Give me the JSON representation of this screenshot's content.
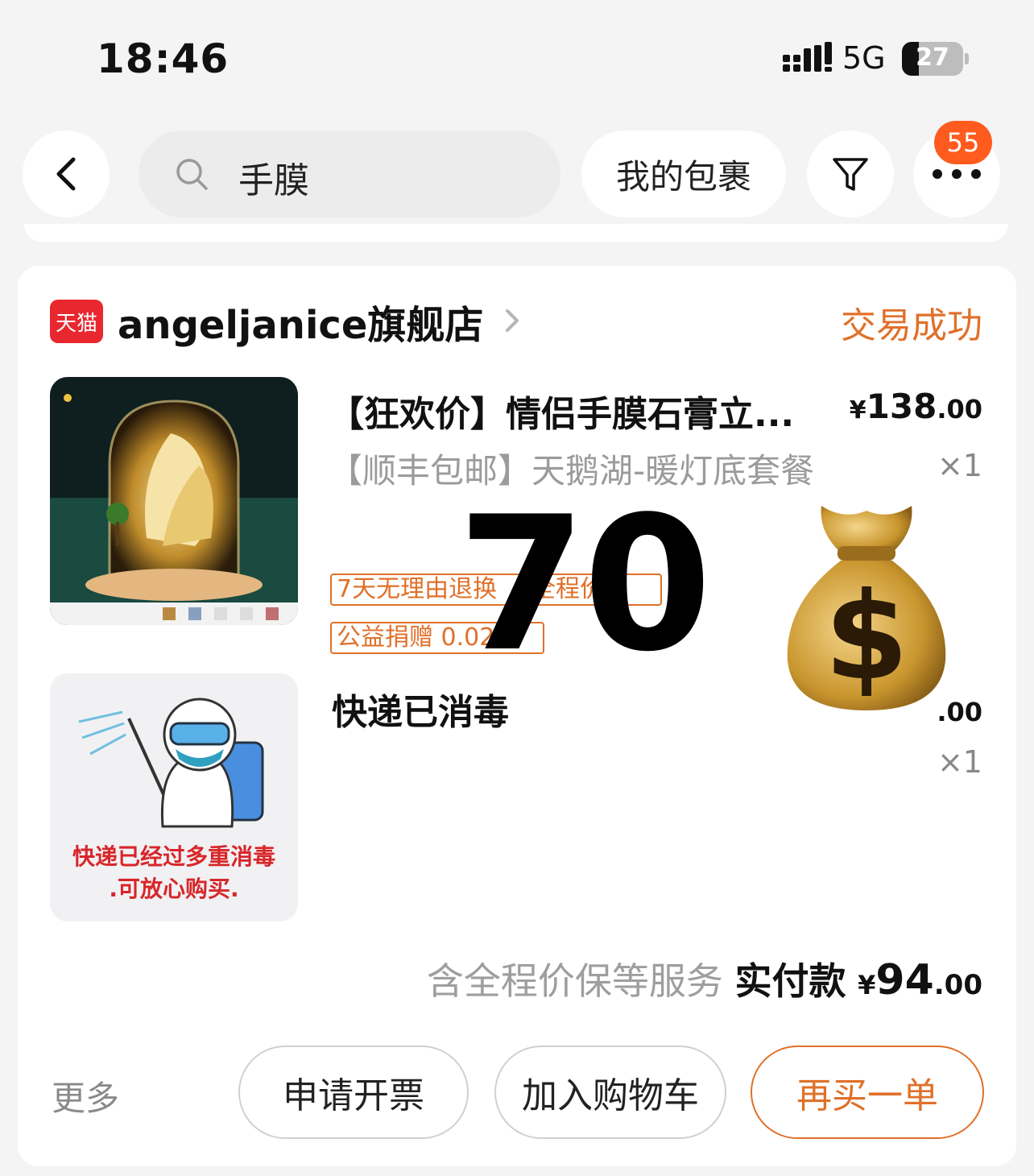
{
  "status_bar": {
    "time": "18:46",
    "network": "5G",
    "battery": "27",
    "battery_level": 0.27
  },
  "nav": {
    "search_text": "手膜",
    "my_packages": "我的包裹",
    "more_badge": "55"
  },
  "order": {
    "tmall_badge": "天猫",
    "shop_name": "angeljanice旗舰店",
    "status": "交易成功",
    "item1": {
      "name": "【狂欢价】情侣手膜石膏立...",
      "sku": "【顺丰包邮】天鹅湖-暖灯底套餐",
      "price_symbol": "¥",
      "price_int": "138",
      "price_dec": ".00",
      "qty": "×1",
      "tag1": "7天无理由退换",
      "tag2": "全程价保",
      "tag3": "公益捐赠 0.02元"
    },
    "item2": {
      "name": "快递已消毒",
      "image_caption_line1": "快递已经过多重消毒",
      "image_caption_line2": ".可放心购买.",
      "price_dec": ".00",
      "qty": "×1"
    },
    "total": {
      "note": "含全程价保等服务",
      "label": "实付款",
      "symbol": "¥",
      "int": "94",
      "dec": ".00"
    }
  },
  "actions": {
    "more": "更多",
    "invoice": "申请开票",
    "add_cart": "加入购物车",
    "rebuy": "再买一单"
  },
  "overlay": {
    "number": "70",
    "emoji": "money-bag-icon"
  },
  "colors": {
    "accent": "#e0702a",
    "badge": "#ff5b1f",
    "tmall": "#e9272e"
  }
}
